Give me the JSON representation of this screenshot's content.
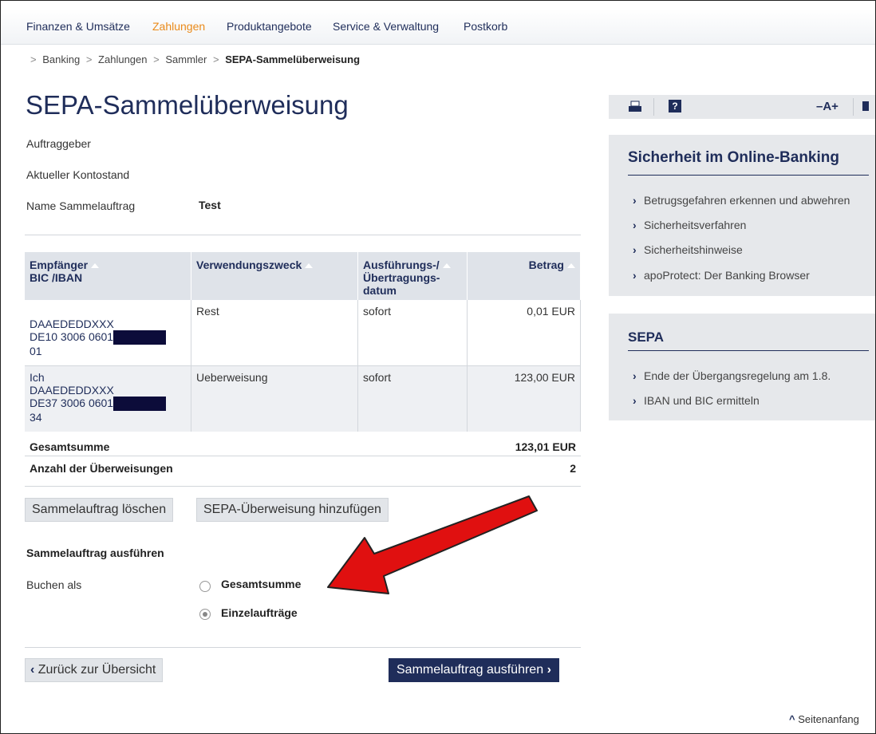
{
  "nav": [
    "Finanzen & Umsätze",
    "Zahlungen",
    "Produktangebote",
    "Service & Verwaltung",
    "Postkorb"
  ],
  "breadcrumb": [
    "Banking",
    "Zahlungen",
    "Sammler",
    "SEPA-Sammelüberweisung"
  ],
  "page_title": "SEPA-Sammelüberweisung",
  "form": {
    "auftraggeber_label": "Auftraggeber",
    "kontostand_label": "Aktueller Kontostand",
    "name_label": "Name Sammelauftrag",
    "name_value": "Test"
  },
  "table": {
    "headers": [
      "Empfänger",
      "BIC /IBAN",
      "Verwendungszweck",
      "Ausführungs-/",
      "Übertragungs-",
      "datum",
      "Betrag"
    ],
    "rows": [
      {
        "name": "",
        "bic": "DAAEDEDDXXX",
        "iban": "DE10 3006 0601",
        "iban_end": "01",
        "purpose": "Rest",
        "date": "sofort",
        "amount": "0,01 EUR"
      },
      {
        "name": "Ich",
        "bic": "DAAEDEDDXXX",
        "iban": "DE37 3006 0601",
        "iban_end": "34",
        "purpose": "Ueberweisung",
        "date": "sofort",
        "amount": "123,00 EUR"
      }
    ],
    "total_label": "Gesamtsumme",
    "total_value": "123,01 EUR",
    "count_label": "Anzahl der Überweisungen",
    "count_value": "2"
  },
  "buttons": {
    "delete": "Sammelauftrag löschen",
    "add": "SEPA-Überweisung hinzufügen",
    "back": "Zurück zur Übersicht",
    "execute": "Sammelauftrag ausführen"
  },
  "execute_section": {
    "title": "Sammelauftrag ausführen",
    "book_as_label": "Buchen als",
    "options": [
      "Gesamtsumme",
      "Einzelaufträge"
    ],
    "selected": "Einzelaufträge"
  },
  "toolbar": {
    "font_size": "–A+"
  },
  "security_panel": {
    "title": "Sicherheit im Online-Banking",
    "links": [
      "Betrugsgefahren erkennen und abwehren",
      "Sicherheitsverfahren",
      "Sicherheitshinweise",
      "apoProtect: Der Banking Browser"
    ]
  },
  "sepa_panel": {
    "title": "SEPA",
    "links": [
      "Ende der Übergangsregelung am 1.8.",
      "IBAN und BIC ermitteln"
    ]
  },
  "footer": {
    "top_link": "Seitenanfang"
  },
  "colors": {
    "brand": "#1f2d5a",
    "active_nav": "#ea8a1a",
    "annotation_arrow": "#e01010"
  }
}
